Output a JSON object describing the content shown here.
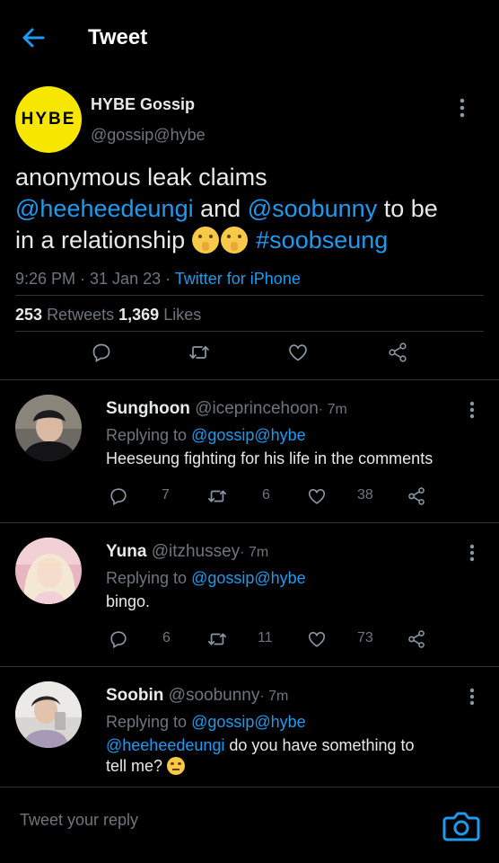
{
  "header": {
    "title": "Tweet"
  },
  "tweet": {
    "avatar_text": "HYBE",
    "name": "HYBE Gossip",
    "handle": "@gossip@hybe",
    "text_1": "anonymous leak claims",
    "mention_1": "@heeheedeungi",
    "text_and": "and",
    "mention_2": "@soobunny",
    "text_2": "to be",
    "text_3": "in a relationship",
    "emoji_name": "shushing-face",
    "hashtag": "#soobseung",
    "time": "9:26 PM · 31 Jan 23 · ",
    "source": "Twitter for iPhone",
    "retweets": "253",
    "retweets_label": "Retweets",
    "likes": "1,369",
    "likes_label": "Likes"
  },
  "replies": [
    {
      "name": "Sunghoon",
      "handle": "@iceprincehoon",
      "time": "· 7m",
      "replying_to_label": "Replying to",
      "replying_to": "@gossip@hybe",
      "text": "Heeseung fighting for his life in the comments",
      "reply_count": "7",
      "retweet_count": "6",
      "like_count": "38"
    },
    {
      "name": "Yuna",
      "handle": "@itzhussey",
      "time": "· 7m",
      "replying_to_label": "Replying to",
      "replying_to": "@gossip@hybe",
      "text": "bingo.",
      "reply_count": "6",
      "retweet_count": "11",
      "like_count": "73"
    },
    {
      "name": "Soobin",
      "handle": "@soobunny",
      "time": "· 7m",
      "replying_to_label": "Replying to",
      "replying_to": "@gossip@hybe",
      "mention": "@heeheedeungi",
      "text": "do you have something to tell me?",
      "emoji_name": "face-with-raised-eyebrow"
    }
  ],
  "composer": {
    "placeholder": "Tweet your reply"
  },
  "colors": {
    "accent": "#1d9bf0",
    "background": "#000000",
    "muted": "#6e767d",
    "avatar_yellow": "#f6e600"
  }
}
